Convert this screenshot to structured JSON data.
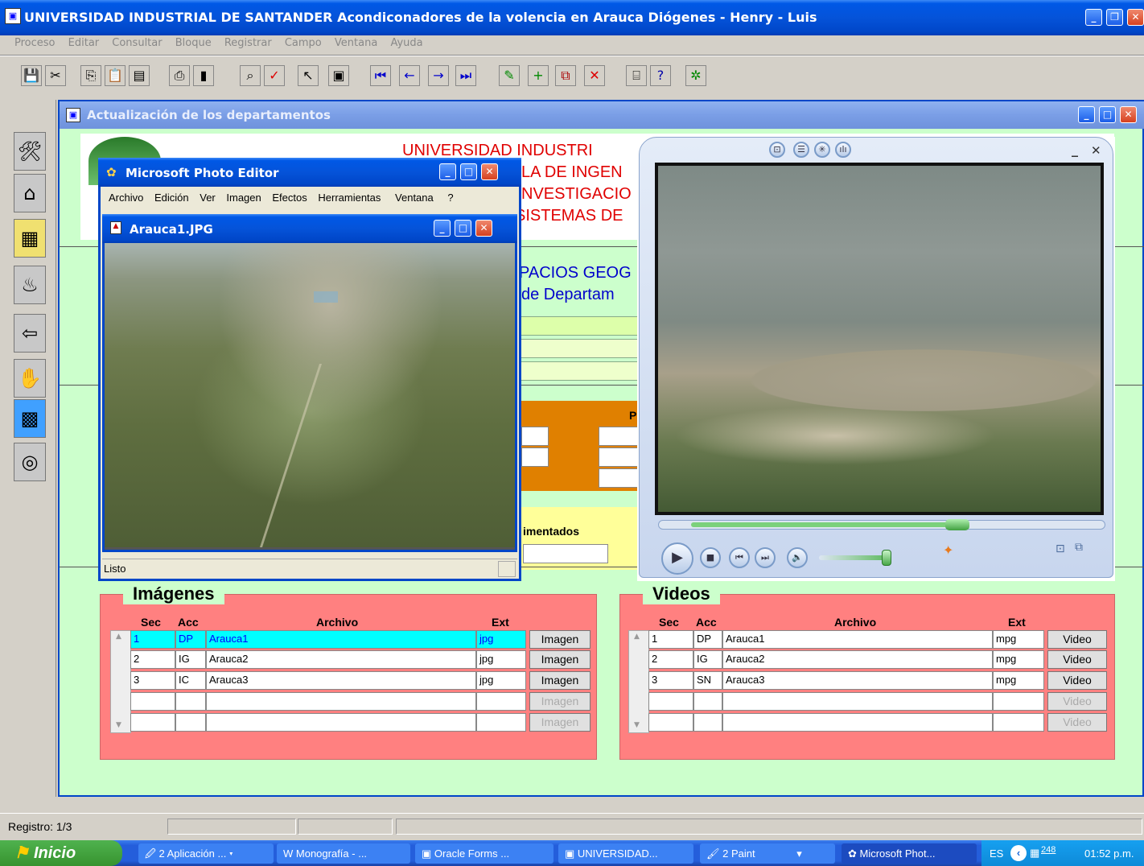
{
  "app": {
    "title": "UNIVERSIDAD INDUSTRIAL DE SANTANDER  Acondiconadores de la volencia en Arauca  Diógenes - Henry - Luis",
    "menu": [
      "Proceso",
      "Editar",
      "Consultar",
      "Bloque",
      "Registrar",
      "Campo",
      "Ventana",
      "Ayuda"
    ]
  },
  "form": {
    "title": "Actualización de los departamentos",
    "header_lines": [
      "UNIVERSIDAD INDUSTRI",
      "LA DE INGEN",
      "NVESTIGACIO",
      "SISTEMAS DE"
    ],
    "subtitle_lines": [
      "PACIOS GEOG",
      "de Departam"
    ],
    "orange_label": "P",
    "yellow_label": "imentados"
  },
  "photo_editor": {
    "title": "Microsoft Photo Editor",
    "menu": [
      "Archivo",
      "Edición",
      "Ver",
      "Imagen",
      "Efectos",
      "Herramientas",
      "Ventana",
      "?"
    ],
    "doc_title": "Arauca1.JPG",
    "status": "Listo"
  },
  "imagenes": {
    "title": "Imágenes",
    "headers": {
      "sec": "Sec",
      "acc": "Acc",
      "archivo": "Archivo",
      "ext": "Ext"
    },
    "rows": [
      {
        "sec": "1",
        "acc": "DP",
        "archivo": "Arauca1",
        "ext": "jpg",
        "btn": "Imagen"
      },
      {
        "sec": "2",
        "acc": "IG",
        "archivo": "Arauca2",
        "ext": "jpg",
        "btn": "Imagen"
      },
      {
        "sec": "3",
        "acc": "IC",
        "archivo": "Arauca3",
        "ext": "jpg",
        "btn": "Imagen"
      },
      {
        "sec": "",
        "acc": "",
        "archivo": "",
        "ext": "",
        "btn": "Imagen"
      },
      {
        "sec": "",
        "acc": "",
        "archivo": "",
        "ext": "",
        "btn": "Imagen"
      }
    ]
  },
  "videos": {
    "title": "Videos",
    "headers": {
      "sec": "Sec",
      "acc": "Acc",
      "archivo": "Archivo",
      "ext": "Ext"
    },
    "rows": [
      {
        "sec": "1",
        "acc": "DP",
        "archivo": "Arauca1",
        "ext": "mpg",
        "btn": "Video"
      },
      {
        "sec": "2",
        "acc": "IG",
        "archivo": "Arauca2",
        "ext": "mpg",
        "btn": "Video"
      },
      {
        "sec": "3",
        "acc": "SN",
        "archivo": "Arauca3",
        "ext": "mpg",
        "btn": "Video"
      },
      {
        "sec": "",
        "acc": "",
        "archivo": "",
        "ext": "",
        "btn": "Video"
      },
      {
        "sec": "",
        "acc": "",
        "archivo": "",
        "ext": "",
        "btn": "Video"
      }
    ]
  },
  "status_bar": {
    "registro": "Registro: 1/3"
  },
  "taskbar": {
    "start": "Inicio",
    "items": [
      "2 Aplicación ...",
      "Monografía - ...",
      "Oracle Forms ...",
      "UNIVERSIDAD...",
      "2 Paint",
      "Microsoft Phot..."
    ],
    "lang": "ES",
    "tray_number": "248",
    "clock": "01:52 p.m."
  },
  "icons": [
    "save-icon",
    "cut-icon",
    "copy-icon",
    "paste-icon",
    "clear-icon",
    "print-icon",
    "exit-icon",
    "find-icon",
    "check-icon",
    "pointer-icon",
    "clipboard-icon",
    "first-record-icon",
    "previous-record-icon",
    "next-record-icon",
    "last-record-icon",
    "edit-icon",
    "insert-record-icon",
    "duplicate-icon",
    "delete-record-icon",
    "query-icon",
    "help-icon",
    "wizard-icon"
  ],
  "colors": {
    "xp_blue": "#0553d9",
    "panel_red": "#ff8080",
    "orange": "#e08000",
    "selection": "#00ffff",
    "taskbar": "#245edb"
  }
}
